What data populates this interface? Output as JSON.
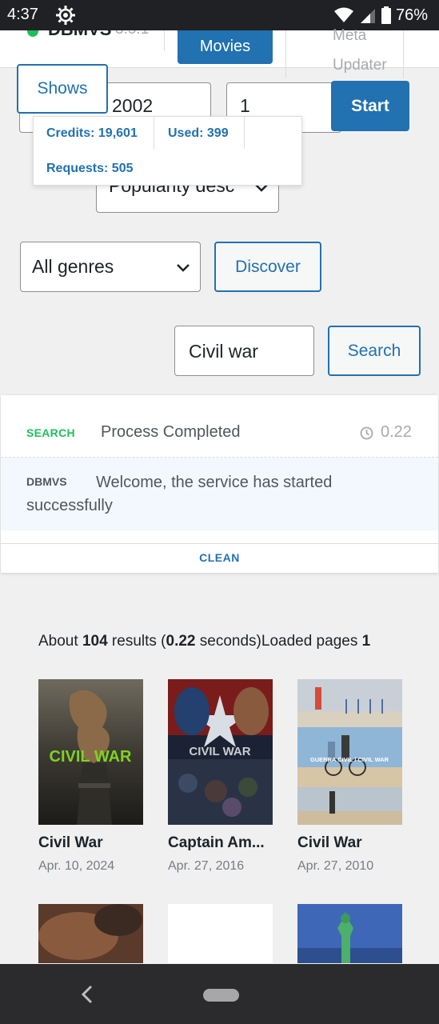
{
  "status_bar": {
    "time": "4:37",
    "battery": "76%",
    "icons": [
      "settings-gear-icon",
      "wifi-icon",
      "signal-icon",
      "battery-icon"
    ]
  },
  "nav": {
    "brand_name": "DBMVS",
    "brand_version": "3.5.1",
    "movies_label": "Movies",
    "meta_label_line1": "Meta",
    "meta_label_line2": "Updater"
  },
  "form": {
    "shows_label": "Shows",
    "year_value": "2002",
    "page_value": "1",
    "start_label": "Start",
    "sort_value": "Popularity desc",
    "genre_value": "All genres",
    "discover_label": "Discover",
    "search_value": "Civil war",
    "search_label": "Search"
  },
  "credits": {
    "credits": "Credits: 19,601",
    "used": "Used: 399",
    "requests": "Requests: 505"
  },
  "log": {
    "entries": [
      {
        "tag": "SEARCH",
        "message": "Process Completed",
        "time": "0.22"
      },
      {
        "tag": "DBMVS",
        "message": "Welcome, the service has started successfully"
      }
    ],
    "clean_label": "CLEAN"
  },
  "summary": {
    "about": "About",
    "count": "104",
    "results": "results (",
    "seconds": "0.22",
    "seconds_suffix": "seconds)",
    "loaded": "Loaded pages",
    "pages": "1"
  },
  "results": [
    {
      "title": "Civil War",
      "date": "Apr. 10, 2024",
      "poster_text": "CIVIL WAR"
    },
    {
      "title": "Captain Am...",
      "date": "Apr. 27, 2016",
      "poster_text": "CIVIL WAR"
    },
    {
      "title": "Civil War",
      "date": "Apr. 27, 2010",
      "poster_text": "GUERRA CIVIL / CIVIL WAR"
    }
  ],
  "colors": {
    "accent": "#2271b1",
    "success": "#1ec05a",
    "background": "#f0f0f1"
  }
}
